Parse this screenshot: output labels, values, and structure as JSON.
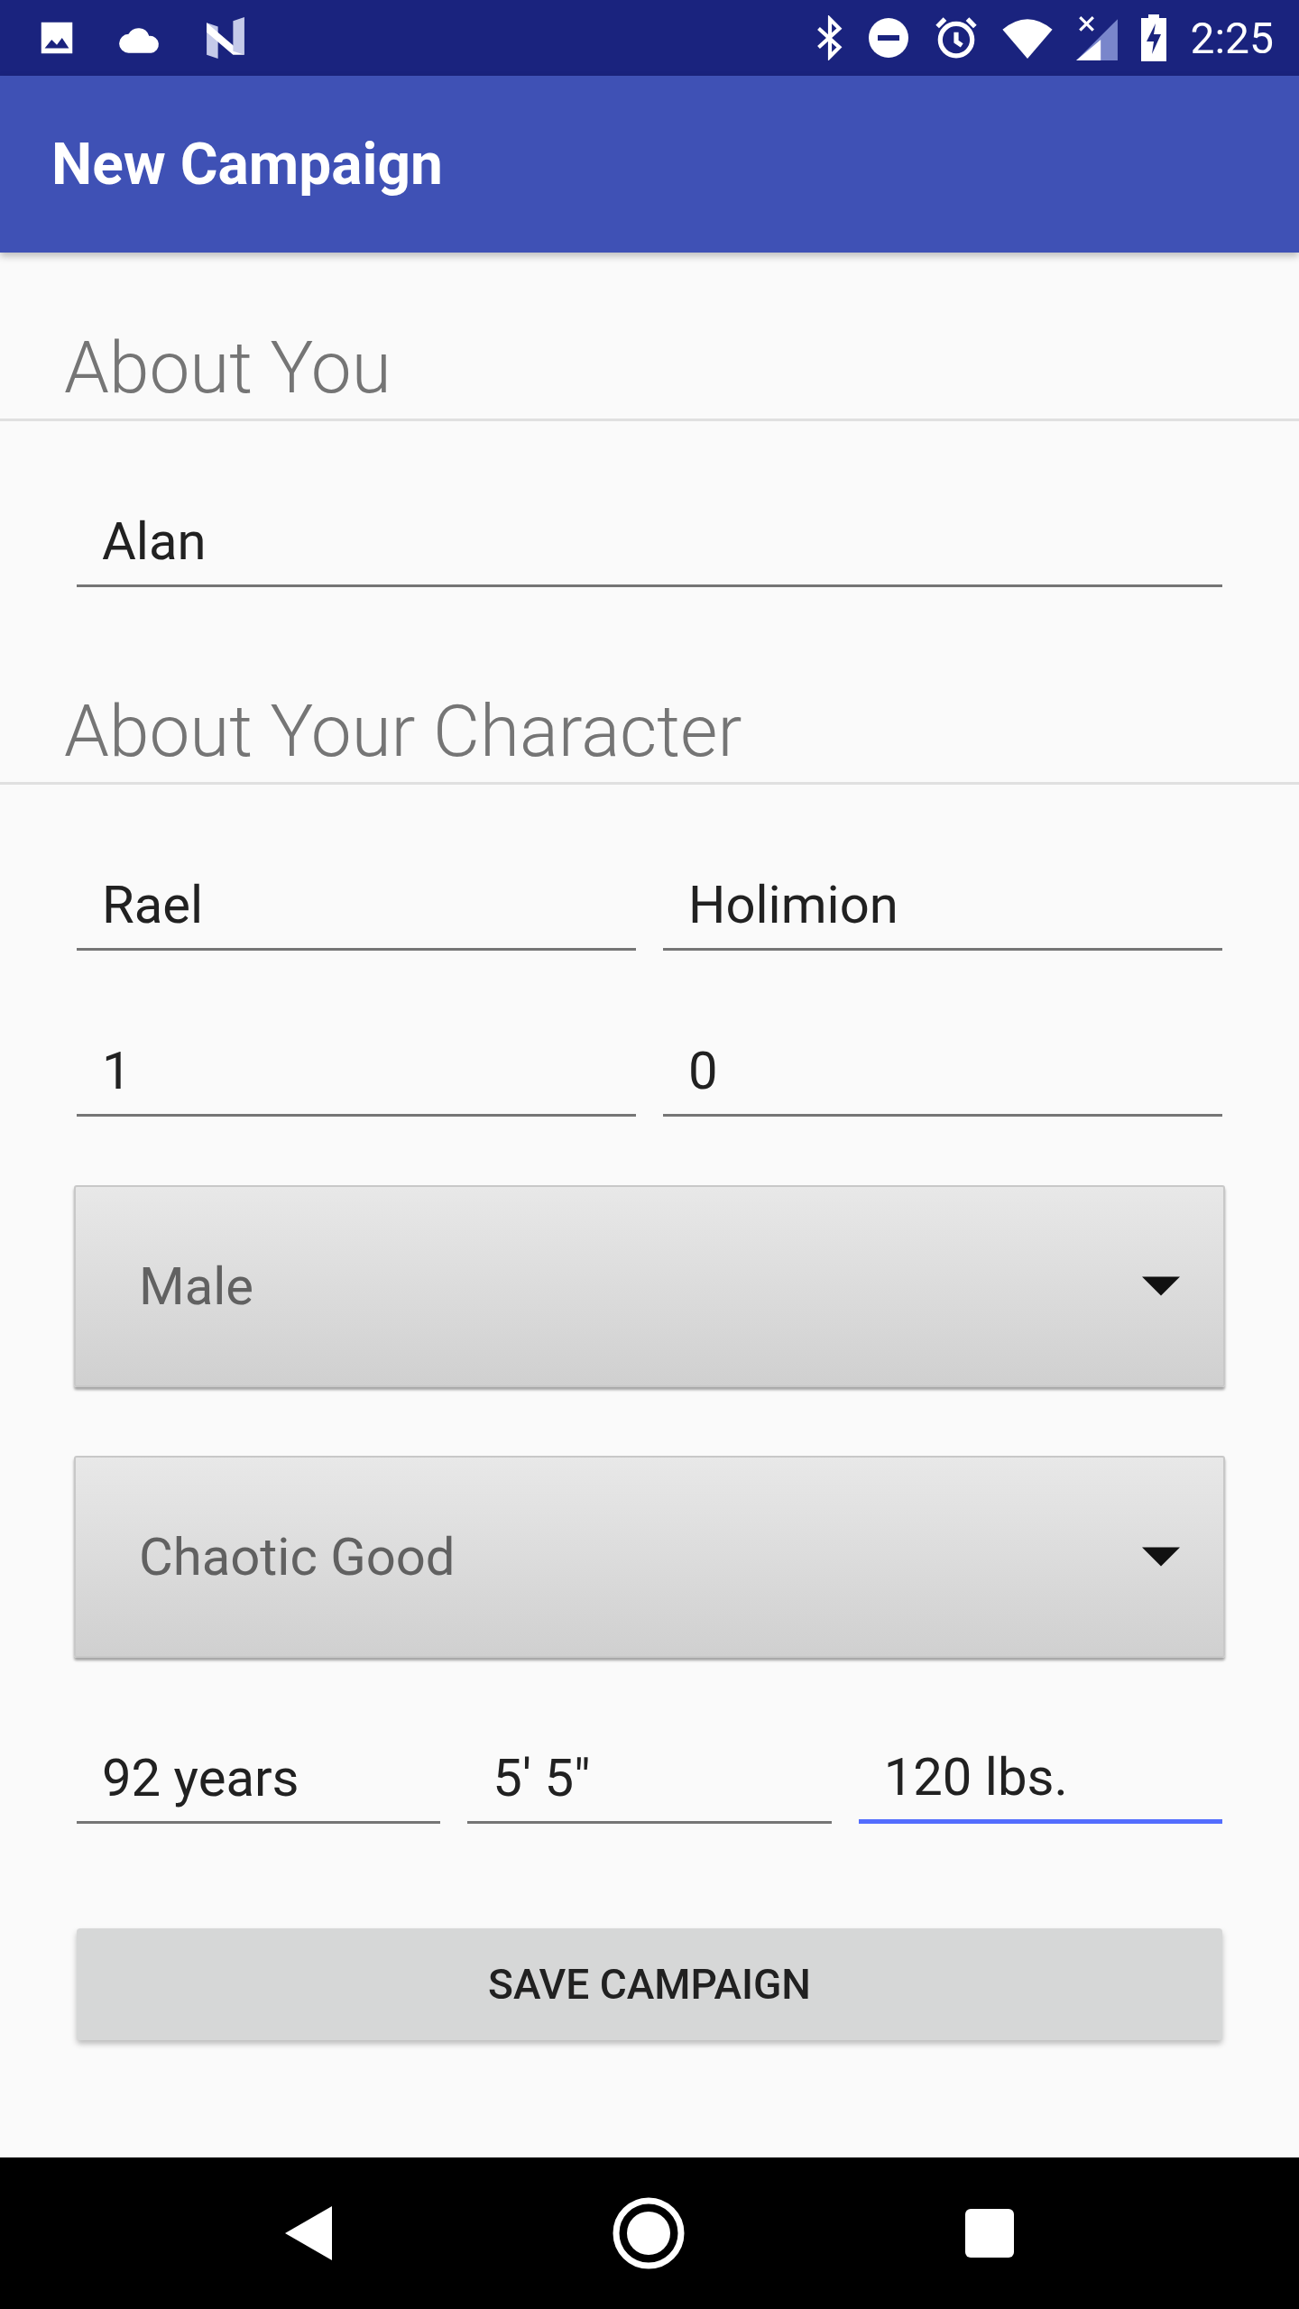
{
  "status_bar": {
    "time": "2:25"
  },
  "app_bar": {
    "title": "New Campaign"
  },
  "sections": [
    {
      "heading": "About You",
      "rows": [
        {
          "kind": "fields",
          "fields": [
            {
              "value": "Alan",
              "focused": false
            }
          ]
        }
      ]
    },
    {
      "heading": "About Your Character",
      "rows": [
        {
          "kind": "fields",
          "fields": [
            {
              "value": "Rael",
              "focused": false
            },
            {
              "value": "Holimion",
              "focused": false
            }
          ]
        },
        {
          "kind": "fields",
          "fields": [
            {
              "value": "1",
              "focused": false
            },
            {
              "value": "0",
              "focused": false
            }
          ]
        },
        {
          "kind": "spinner",
          "value": "Male"
        },
        {
          "kind": "spinner",
          "value": "Chaotic Good"
        },
        {
          "kind": "fields",
          "fields": [
            {
              "value": "92 years",
              "focused": false
            },
            {
              "value": "5' 5\"",
              "focused": false
            },
            {
              "value": "120 lbs.",
              "focused": true
            }
          ]
        }
      ]
    }
  ],
  "button": {
    "label": "SAVE CAMPAIGN"
  }
}
